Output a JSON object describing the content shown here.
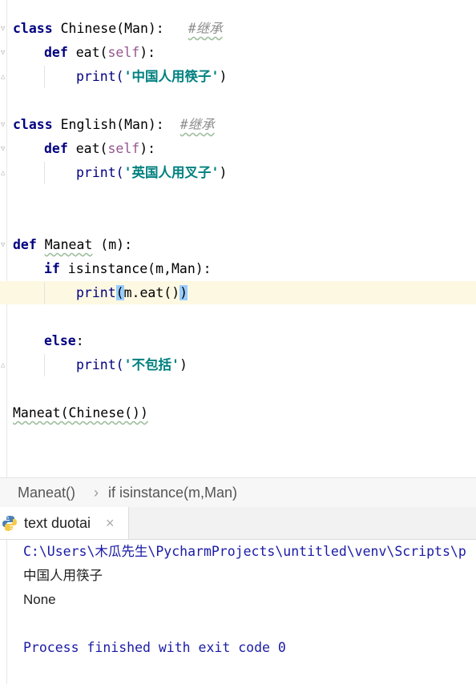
{
  "editor": {
    "lines": [
      {
        "class_kw": "class",
        "name": " Chinese(Man):",
        "comment": "#继承"
      },
      {
        "def_kw": "def",
        "name": " eat(",
        "self": "self",
        "tail": "):"
      },
      {
        "print": "print(",
        "str": "'中国人用筷子'",
        "tail": ")"
      },
      {
        "class_kw": "class",
        "name": " English(Man):",
        "comment": "#继承"
      },
      {
        "def_kw": "def",
        "name": " eat(",
        "self": "self",
        "tail": "):"
      },
      {
        "print": "print(",
        "str": "'英国人用叉子'",
        "tail": ")"
      },
      {
        "def_kw": "def",
        "name_a": " ",
        "name_b": "Maneat",
        "tail": " (m):"
      },
      {
        "if_kw": "if",
        "text": " isinstance(m,Man):"
      },
      {
        "print": "print",
        "open": "(",
        "mid": "m.eat()",
        "close": ")"
      },
      {
        "else_kw": "else",
        "tail": ":"
      },
      {
        "print": "print(",
        "str": "'不包括'",
        "tail": ")"
      },
      {
        "text": "Maneat(Chinese())"
      }
    ]
  },
  "breadcrumb": {
    "item1": "Maneat()",
    "separator": "›",
    "item2": "if isinstance(m,Man)"
  },
  "run": {
    "tab_label": "text duotai",
    "close": "×"
  },
  "console": {
    "cmd": "C:\\Users\\木瓜先生\\PycharmProjects\\untitled\\venv\\Scripts\\p",
    "out1": "中国人用筷子",
    "out2": "None",
    "finish": "Process finished with exit code 0"
  },
  "colors": {
    "keyword": "#000080",
    "string": "#008080",
    "self": "#94558d",
    "comment": "#8c8c8c",
    "caret_line": "#fdf8e2",
    "console_path": "#1a1aa6"
  }
}
